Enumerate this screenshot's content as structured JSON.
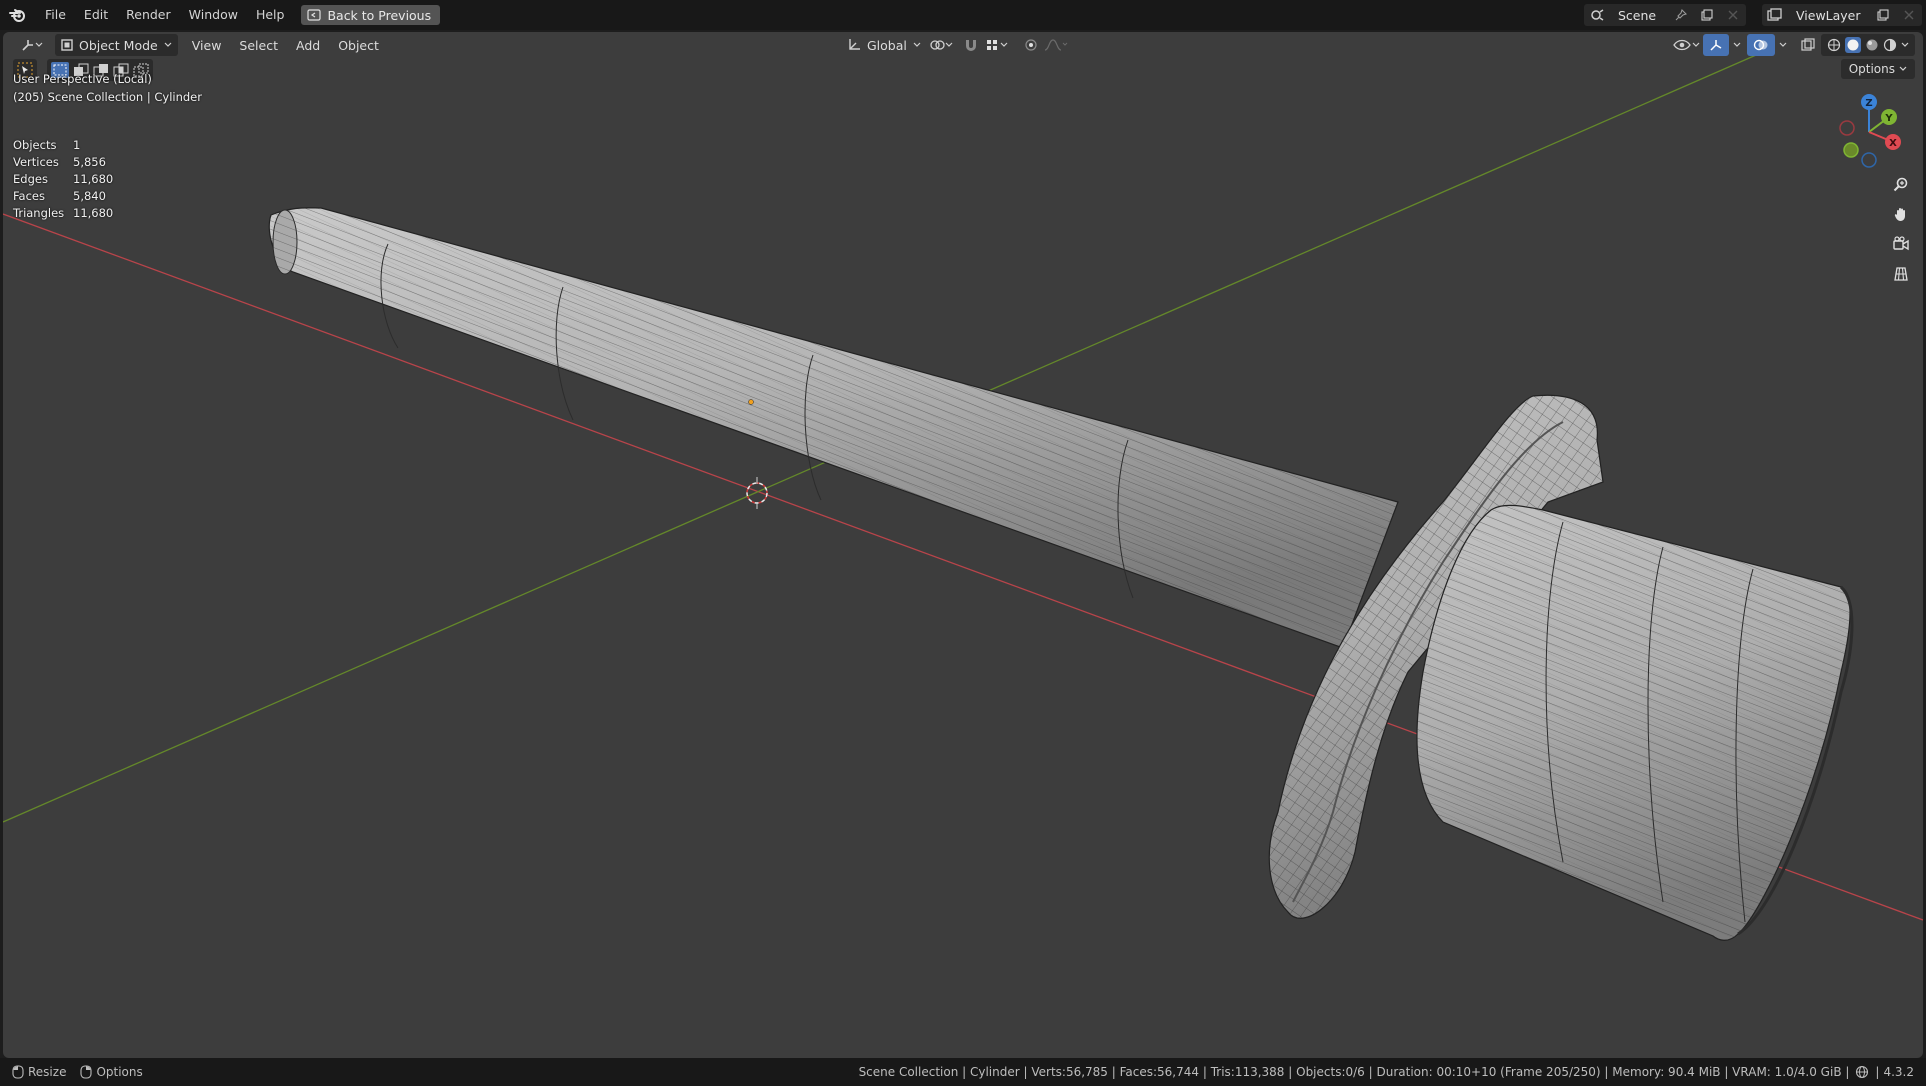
{
  "menu": {
    "items": [
      "File",
      "Edit",
      "Render",
      "Window",
      "Help"
    ],
    "back_button": "Back to Previous"
  },
  "top_right": {
    "scene_label": "Scene",
    "view_layer_label": "ViewLayer"
  },
  "viewport_header": {
    "mode": "Object Mode",
    "menus": [
      "View",
      "Select",
      "Add",
      "Object"
    ],
    "transform_orientation": "Global",
    "options_label": "Options"
  },
  "overlay": {
    "view_name": "User Perspective (Local)",
    "collection_line": "(205) Scene Collection | Cylinder",
    "stats": [
      {
        "label": "Objects",
        "value": "1"
      },
      {
        "label": "Vertices",
        "value": "5,856"
      },
      {
        "label": "Edges",
        "value": "11,680"
      },
      {
        "label": "Faces",
        "value": "5,840"
      },
      {
        "label": "Triangles",
        "value": "11,680"
      }
    ]
  },
  "gizmo": {
    "z_label": "Z",
    "y_label": "Y",
    "x_label": "X",
    "colors": {
      "x": "#e04a52",
      "y": "#7fb533",
      "z": "#3b83d8"
    }
  },
  "statusbar": {
    "left": [
      {
        "icon": "mouse-left-icon",
        "label": "Resize"
      },
      {
        "icon": "mouse-right-icon",
        "label": "Options"
      }
    ],
    "info": "Scene Collection | Cylinder | Verts:56,785 | Faces:56,744 | Tris:113,388 | Objects:0/6 | Duration: 00:10+10 (Frame 205/250) | Memory: 90.4 MiB | VRAM: 1.0/4.0 GiB |",
    "version": "4.3.2"
  },
  "colors": {
    "viewport_bg": "#3d3d3d",
    "x_axis": "#c9464c",
    "y_axis": "#6b8f2a",
    "accent": "#4772b3"
  }
}
